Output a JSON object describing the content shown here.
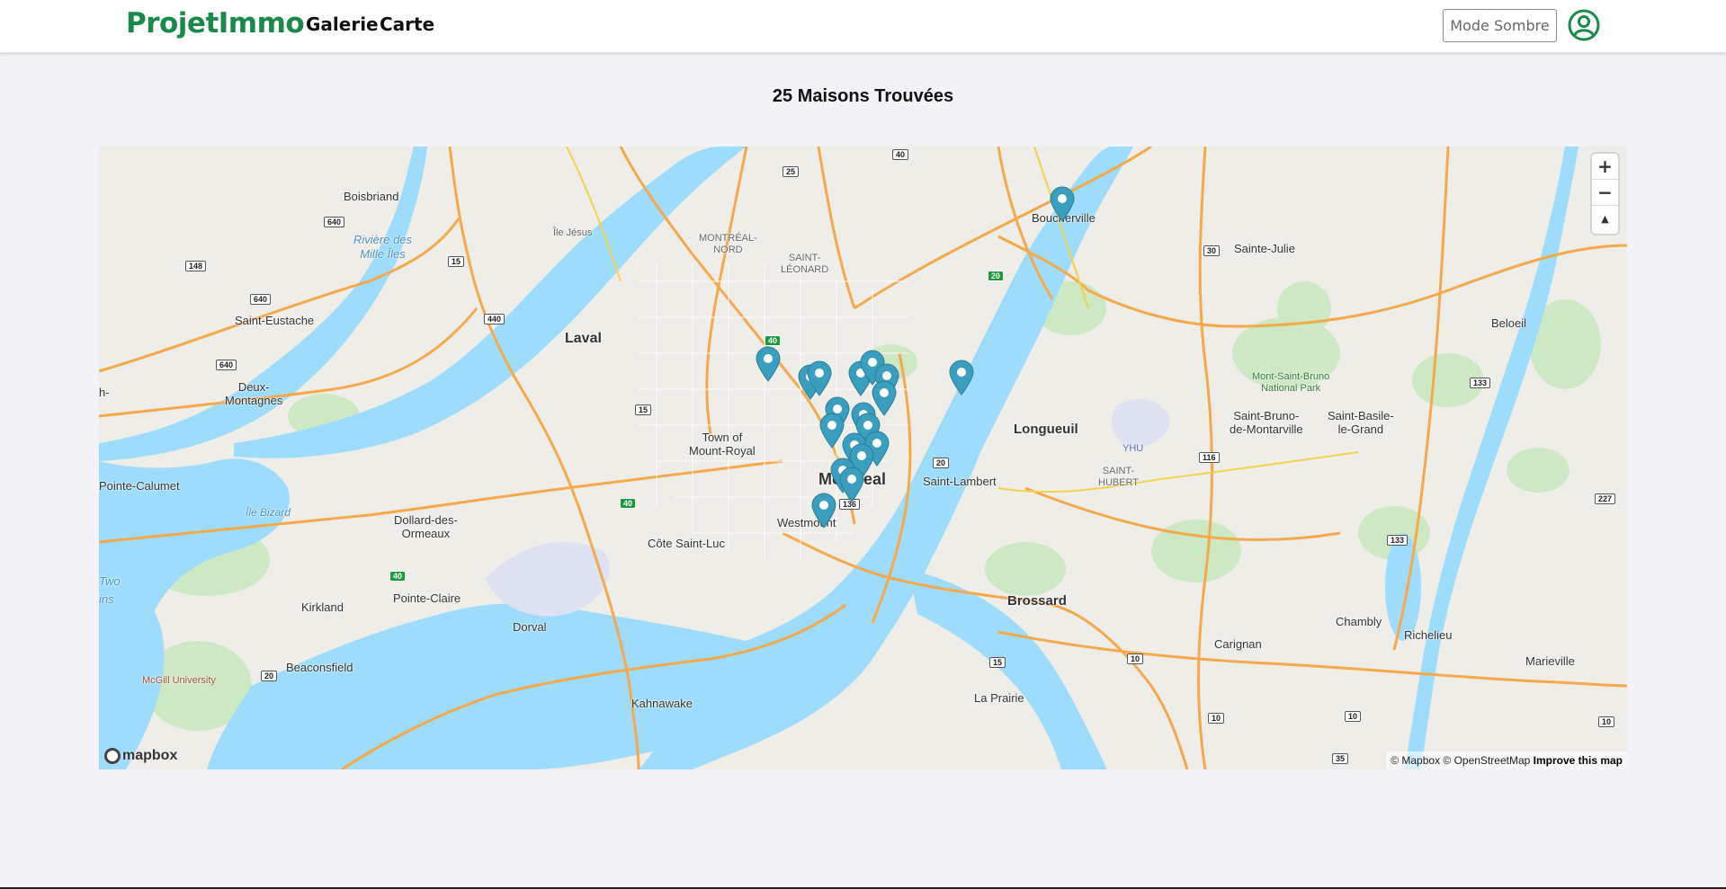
{
  "header": {
    "brand": "ProjetImmo",
    "nav": [
      "Galerie",
      "Carte"
    ],
    "mode_button": "Mode Sombre",
    "brand_color": "#1a8a4a"
  },
  "main": {
    "title": "25 Maisons Trouvées"
  },
  "map": {
    "zoom_in": "+",
    "zoom_out": "−",
    "reset_north": "▲",
    "attribution": "© Mapbox © OpenStreetMap",
    "improve": "Improve this map",
    "logo": "mapbox",
    "marker_color": "#3a9ebf",
    "labels": {
      "montreal": "Montreal",
      "laval": "Laval",
      "longueuil": "Longueuil",
      "brossard": "Brossard",
      "boisbriand": "Boisbriand",
      "saint_eustache": "Saint-Eustache",
      "deux_montagnes": "Deux-\nMontagnes",
      "pointe_calumet": "Pointe-Calumet",
      "ile_bizard": "Île Bizard",
      "dollard": "Dollard-des-\nOrmeaux",
      "kirkland": "Kirkland",
      "pointe_claire": "Pointe-Claire",
      "dorval": "Dorval",
      "beaconsfield": "Beaconsfield",
      "mcgill": "McGill University",
      "kahnawake": "Kahnawake",
      "la_prairie": "La Prairie",
      "carignan": "Carignan",
      "chambly": "Chambly",
      "richelieu": "Richelieu",
      "marieville": "Marieville",
      "saint_lambert": "Saint-Lambert",
      "westmount": "Westmount",
      "cote_saint_luc": "Côte Saint-Luc",
      "town_mount_royal": "Town of\nMount-Royal",
      "montreal_nord": "MONTRÉAL-\nNORD",
      "saint_leonard": "SAINT-\nLÉONARD",
      "boucherville": "Boucherville",
      "sainte_julie": "Sainte-Julie",
      "beloeil": "Beloeil",
      "mont_saint_bruno": "Mont-Saint-Bruno\nNational Park",
      "saint_bruno": "Saint-Bruno-\nde-Montarville",
      "saint_basile": "Saint-Basile-\nle-Grand",
      "saint_hubert": "SAINT-\nHUBERT",
      "yhu": "YHU",
      "riviere_mille_iles": "Rivière des\nMille Îles",
      "ile_jesus": "Île Jésus",
      "two": "Two",
      "ins": "ins",
      "h_edge": "h-"
    },
    "shields": [
      "640",
      "148",
      "640",
      "640",
      "15",
      "440",
      "15",
      "40",
      "25",
      "40",
      "20",
      "136",
      "20",
      "30",
      "133",
      "116",
      "133",
      "227",
      "10",
      "10",
      "10",
      "10",
      "35",
      "20",
      "15",
      "40",
      "40"
    ]
  }
}
